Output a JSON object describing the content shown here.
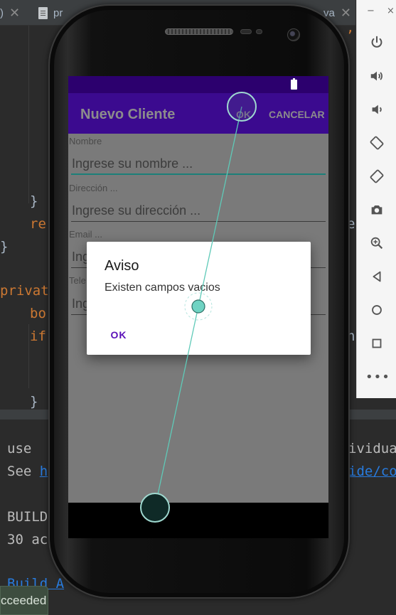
{
  "ide": {
    "tabs": [
      {
        "text": ")"
      },
      {
        "text": "pr"
      },
      {
        "text": "va"
      }
    ],
    "code_lines": [
      {
        "text": "}",
        "color": "#a9b7c6"
      },
      {
        "text": "re",
        "color": "#cc7832"
      },
      {
        "text": "}",
        "color": "#a9b7c6"
      },
      {
        "text": "privat",
        "color": "#cc7832"
      },
      {
        "text": "bo",
        "color": "#cc7832"
      },
      {
        "text": "if",
        "color": "#cc7832"
      },
      {
        "text": "}",
        "color": "#a9b7c6"
      }
    ],
    "right_fragments": [
      {
        "text": ","
      },
      {
        "text": "e"
      },
      {
        "text": "n"
      }
    ],
    "console": {
      "lines": [
        {
          "left": "use",
          "right": "ividua"
        },
        {
          "left": "See ",
          "left_link": "h",
          "right_link": "ide/co"
        },
        {
          "left": "BUILD"
        },
        {
          "left": "30 ac"
        },
        {
          "left_link": "Build A"
        }
      ]
    },
    "status_text": "cceeded"
  },
  "emulator_toolbar": {
    "minimize": "−",
    "close": "×",
    "buttons": [
      {
        "name": "power-icon"
      },
      {
        "name": "volume-up-icon"
      },
      {
        "name": "volume-down-icon"
      },
      {
        "name": "rotate-left-icon"
      },
      {
        "name": "rotate-right-icon"
      },
      {
        "name": "camera-icon"
      },
      {
        "name": "zoom-icon"
      },
      {
        "name": "back-icon"
      },
      {
        "name": "home-icon"
      },
      {
        "name": "overview-icon"
      }
    ],
    "more": "•••"
  },
  "app": {
    "title": "Nuevo Cliente",
    "actions": {
      "ok": "OK",
      "cancel": "CANCELAR"
    },
    "fields": [
      {
        "label": "Nombre",
        "placeholder": "Ingrese su nombre ..."
      },
      {
        "label": "Dirección ...",
        "placeholder": "Ingrese su dirección ..."
      },
      {
        "label": "Email ...",
        "placeholder": "Ing"
      },
      {
        "label": "Tele",
        "placeholder": "Ing"
      }
    ]
  },
  "dialog": {
    "title": "Aviso",
    "message": "Existen campos vacios",
    "ok": "OK"
  },
  "colors": {
    "statusbar": "#2c006e",
    "appbar": "#3b0a8f",
    "accent": "#5a10b8",
    "input_focus": "#1c7f79",
    "touch": "#5fcab8"
  }
}
